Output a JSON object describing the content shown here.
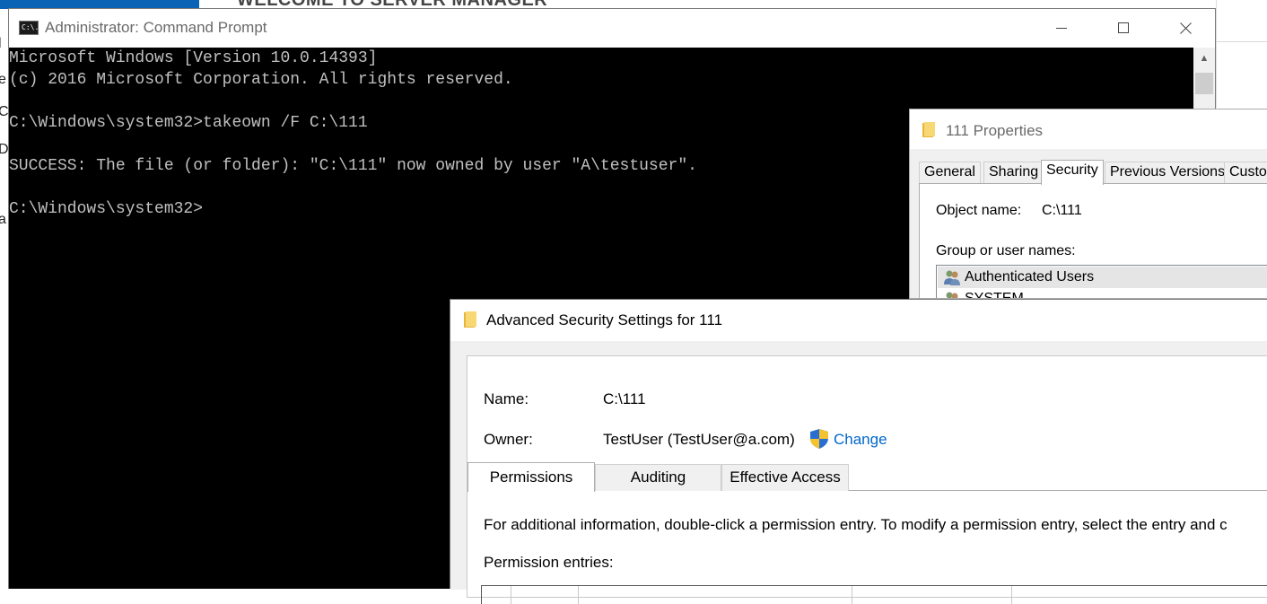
{
  "server_manager": {
    "welcome_heading": "WELCOME TO SERVER MANAGER",
    "nav_fragments": [
      "l",
      "e",
      "C",
      "D",
      "a"
    ],
    "accent_color": "#0a63b4"
  },
  "cmd": {
    "title": "Administrator: Command Prompt",
    "icon_label": "C:\\.",
    "lines": [
      "Microsoft Windows [Version 10.0.14393]",
      "(c) 2016 Microsoft Corporation. All rights reserved.",
      "",
      "C:\\Windows\\system32>takeown /F C:\\111",
      "",
      "SUCCESS: The file (or folder): \"C:\\111\" now owned by user \"A\\testuser\".",
      "",
      "C:\\Windows\\system32>"
    ],
    "scroll_up_glyph": "▲"
  },
  "properties": {
    "title": "111 Properties",
    "tabs": [
      "General",
      "Sharing",
      "Security",
      "Previous Versions",
      "Custo"
    ],
    "active_tab": "Security",
    "object_name_label": "Object name:",
    "object_name_value": "C:\\111",
    "group_label": "Group or user names:",
    "users": [
      "Authenticated Users",
      "SYSTEM"
    ]
  },
  "advanced": {
    "title": "Advanced Security Settings for 111",
    "name_label": "Name:",
    "name_value": "C:\\111",
    "owner_label": "Owner:",
    "owner_value": "TestUser (TestUser@a.com)",
    "change_link": "Change",
    "tabs": [
      "Permissions",
      "Auditing",
      "Effective Access"
    ],
    "active_tab": "Permissions",
    "info_text": "For additional information, double-click a permission entry. To modify a permission entry, select the entry and c",
    "entries_label": "Permission entries:",
    "link_color": "#0066cc"
  }
}
